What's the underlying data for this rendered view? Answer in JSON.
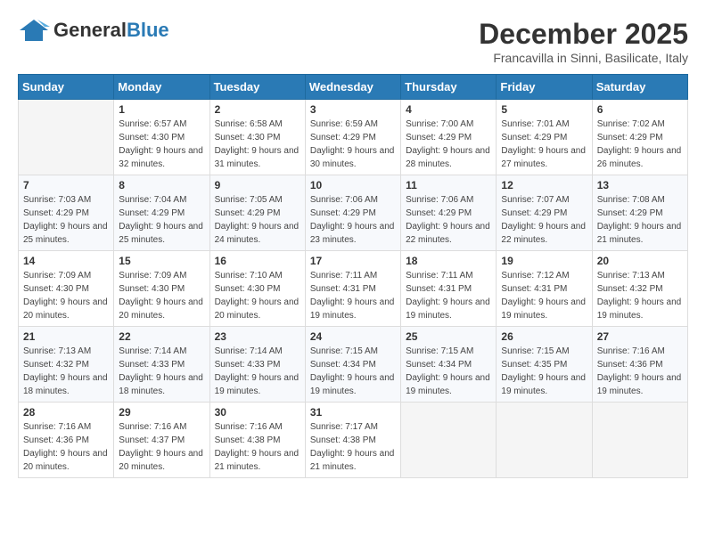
{
  "logo": {
    "general": "General",
    "blue": "Blue"
  },
  "title": "December 2025",
  "subtitle": "Francavilla in Sinni, Basilicate, Italy",
  "days_of_week": [
    "Sunday",
    "Monday",
    "Tuesday",
    "Wednesday",
    "Thursday",
    "Friday",
    "Saturday"
  ],
  "weeks": [
    [
      {
        "day": "",
        "sunrise": "",
        "sunset": "",
        "daylight": ""
      },
      {
        "day": "1",
        "sunrise": "6:57 AM",
        "sunset": "4:30 PM",
        "daylight": "9 hours and 32 minutes."
      },
      {
        "day": "2",
        "sunrise": "6:58 AM",
        "sunset": "4:30 PM",
        "daylight": "9 hours and 31 minutes."
      },
      {
        "day": "3",
        "sunrise": "6:59 AM",
        "sunset": "4:29 PM",
        "daylight": "9 hours and 30 minutes."
      },
      {
        "day": "4",
        "sunrise": "7:00 AM",
        "sunset": "4:29 PM",
        "daylight": "9 hours and 28 minutes."
      },
      {
        "day": "5",
        "sunrise": "7:01 AM",
        "sunset": "4:29 PM",
        "daylight": "9 hours and 27 minutes."
      },
      {
        "day": "6",
        "sunrise": "7:02 AM",
        "sunset": "4:29 PM",
        "daylight": "9 hours and 26 minutes."
      }
    ],
    [
      {
        "day": "7",
        "sunrise": "7:03 AM",
        "sunset": "4:29 PM",
        "daylight": "9 hours and 25 minutes."
      },
      {
        "day": "8",
        "sunrise": "7:04 AM",
        "sunset": "4:29 PM",
        "daylight": "9 hours and 25 minutes."
      },
      {
        "day": "9",
        "sunrise": "7:05 AM",
        "sunset": "4:29 PM",
        "daylight": "9 hours and 24 minutes."
      },
      {
        "day": "10",
        "sunrise": "7:06 AM",
        "sunset": "4:29 PM",
        "daylight": "9 hours and 23 minutes."
      },
      {
        "day": "11",
        "sunrise": "7:06 AM",
        "sunset": "4:29 PM",
        "daylight": "9 hours and 22 minutes."
      },
      {
        "day": "12",
        "sunrise": "7:07 AM",
        "sunset": "4:29 PM",
        "daylight": "9 hours and 22 minutes."
      },
      {
        "day": "13",
        "sunrise": "7:08 AM",
        "sunset": "4:29 PM",
        "daylight": "9 hours and 21 minutes."
      }
    ],
    [
      {
        "day": "14",
        "sunrise": "7:09 AM",
        "sunset": "4:30 PM",
        "daylight": "9 hours and 20 minutes."
      },
      {
        "day": "15",
        "sunrise": "7:09 AM",
        "sunset": "4:30 PM",
        "daylight": "9 hours and 20 minutes."
      },
      {
        "day": "16",
        "sunrise": "7:10 AM",
        "sunset": "4:30 PM",
        "daylight": "9 hours and 20 minutes."
      },
      {
        "day": "17",
        "sunrise": "7:11 AM",
        "sunset": "4:31 PM",
        "daylight": "9 hours and 19 minutes."
      },
      {
        "day": "18",
        "sunrise": "7:11 AM",
        "sunset": "4:31 PM",
        "daylight": "9 hours and 19 minutes."
      },
      {
        "day": "19",
        "sunrise": "7:12 AM",
        "sunset": "4:31 PM",
        "daylight": "9 hours and 19 minutes."
      },
      {
        "day": "20",
        "sunrise": "7:13 AM",
        "sunset": "4:32 PM",
        "daylight": "9 hours and 19 minutes."
      }
    ],
    [
      {
        "day": "21",
        "sunrise": "7:13 AM",
        "sunset": "4:32 PM",
        "daylight": "9 hours and 18 minutes."
      },
      {
        "day": "22",
        "sunrise": "7:14 AM",
        "sunset": "4:33 PM",
        "daylight": "9 hours and 18 minutes."
      },
      {
        "day": "23",
        "sunrise": "7:14 AM",
        "sunset": "4:33 PM",
        "daylight": "9 hours and 19 minutes."
      },
      {
        "day": "24",
        "sunrise": "7:15 AM",
        "sunset": "4:34 PM",
        "daylight": "9 hours and 19 minutes."
      },
      {
        "day": "25",
        "sunrise": "7:15 AM",
        "sunset": "4:34 PM",
        "daylight": "9 hours and 19 minutes."
      },
      {
        "day": "26",
        "sunrise": "7:15 AM",
        "sunset": "4:35 PM",
        "daylight": "9 hours and 19 minutes."
      },
      {
        "day": "27",
        "sunrise": "7:16 AM",
        "sunset": "4:36 PM",
        "daylight": "9 hours and 19 minutes."
      }
    ],
    [
      {
        "day": "28",
        "sunrise": "7:16 AM",
        "sunset": "4:36 PM",
        "daylight": "9 hours and 20 minutes."
      },
      {
        "day": "29",
        "sunrise": "7:16 AM",
        "sunset": "4:37 PM",
        "daylight": "9 hours and 20 minutes."
      },
      {
        "day": "30",
        "sunrise": "7:16 AM",
        "sunset": "4:38 PM",
        "daylight": "9 hours and 21 minutes."
      },
      {
        "day": "31",
        "sunrise": "7:17 AM",
        "sunset": "4:38 PM",
        "daylight": "9 hours and 21 minutes."
      },
      {
        "day": "",
        "sunrise": "",
        "sunset": "",
        "daylight": ""
      },
      {
        "day": "",
        "sunrise": "",
        "sunset": "",
        "daylight": ""
      },
      {
        "day": "",
        "sunrise": "",
        "sunset": "",
        "daylight": ""
      }
    ]
  ],
  "labels": {
    "sunrise": "Sunrise:",
    "sunset": "Sunset:",
    "daylight": "Daylight:"
  }
}
